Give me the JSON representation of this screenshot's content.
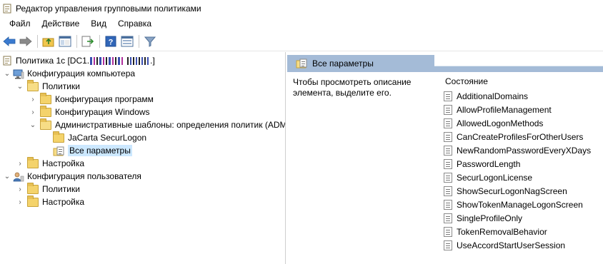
{
  "window": {
    "title": "Редактор управления групповыми политиками"
  },
  "menu": [
    "Файл",
    "Действие",
    "Вид",
    "Справка"
  ],
  "toolbar": {
    "icons": [
      "back-arrow-icon",
      "forward-arrow-icon",
      "up-folder-icon",
      "show-hide-tree-icon",
      "export-list-icon",
      "help-icon",
      "properties-icon",
      "filter-icon"
    ]
  },
  "tree": {
    "root": "Политика 1c [DC1.",
    "computer_config": "Конфигурация компьютера",
    "policies": "Политики",
    "software_settings": "Конфигурация программ",
    "windows_settings": "Конфигурация Windows",
    "admin_templates": "Административные шаблоны: определения политик (ADM",
    "jacarta": "JaCarta SecurLogon",
    "all_settings": "Все параметры",
    "prefs": "Настройка",
    "user_config": "Конфигурация пользователя",
    "user_policies": "Политики",
    "user_prefs": "Настройка"
  },
  "right_pane": {
    "header": "Все параметры",
    "description": "Чтобы просмотреть описание элемента, выделите его.",
    "column_header": "Состояние",
    "settings": [
      "AdditionalDomains",
      "AllowProfileManagement",
      "AllowedLogonMethods",
      "CanCreateProfilesForOtherUsers",
      "NewRandomPasswordEveryXDays",
      "PasswordLength",
      "SecurLogonLicense",
      "ShowSecurLogonNagScreen",
      "ShowTokenManageLogonScreen",
      "SingleProfileOnly",
      "TokenRemovalBehavior",
      "UseAccordStartUserSession"
    ]
  },
  "colors": {
    "header_band": "#a4bbd7",
    "selection": "#cce8ff",
    "folder": "#f4d36b"
  }
}
